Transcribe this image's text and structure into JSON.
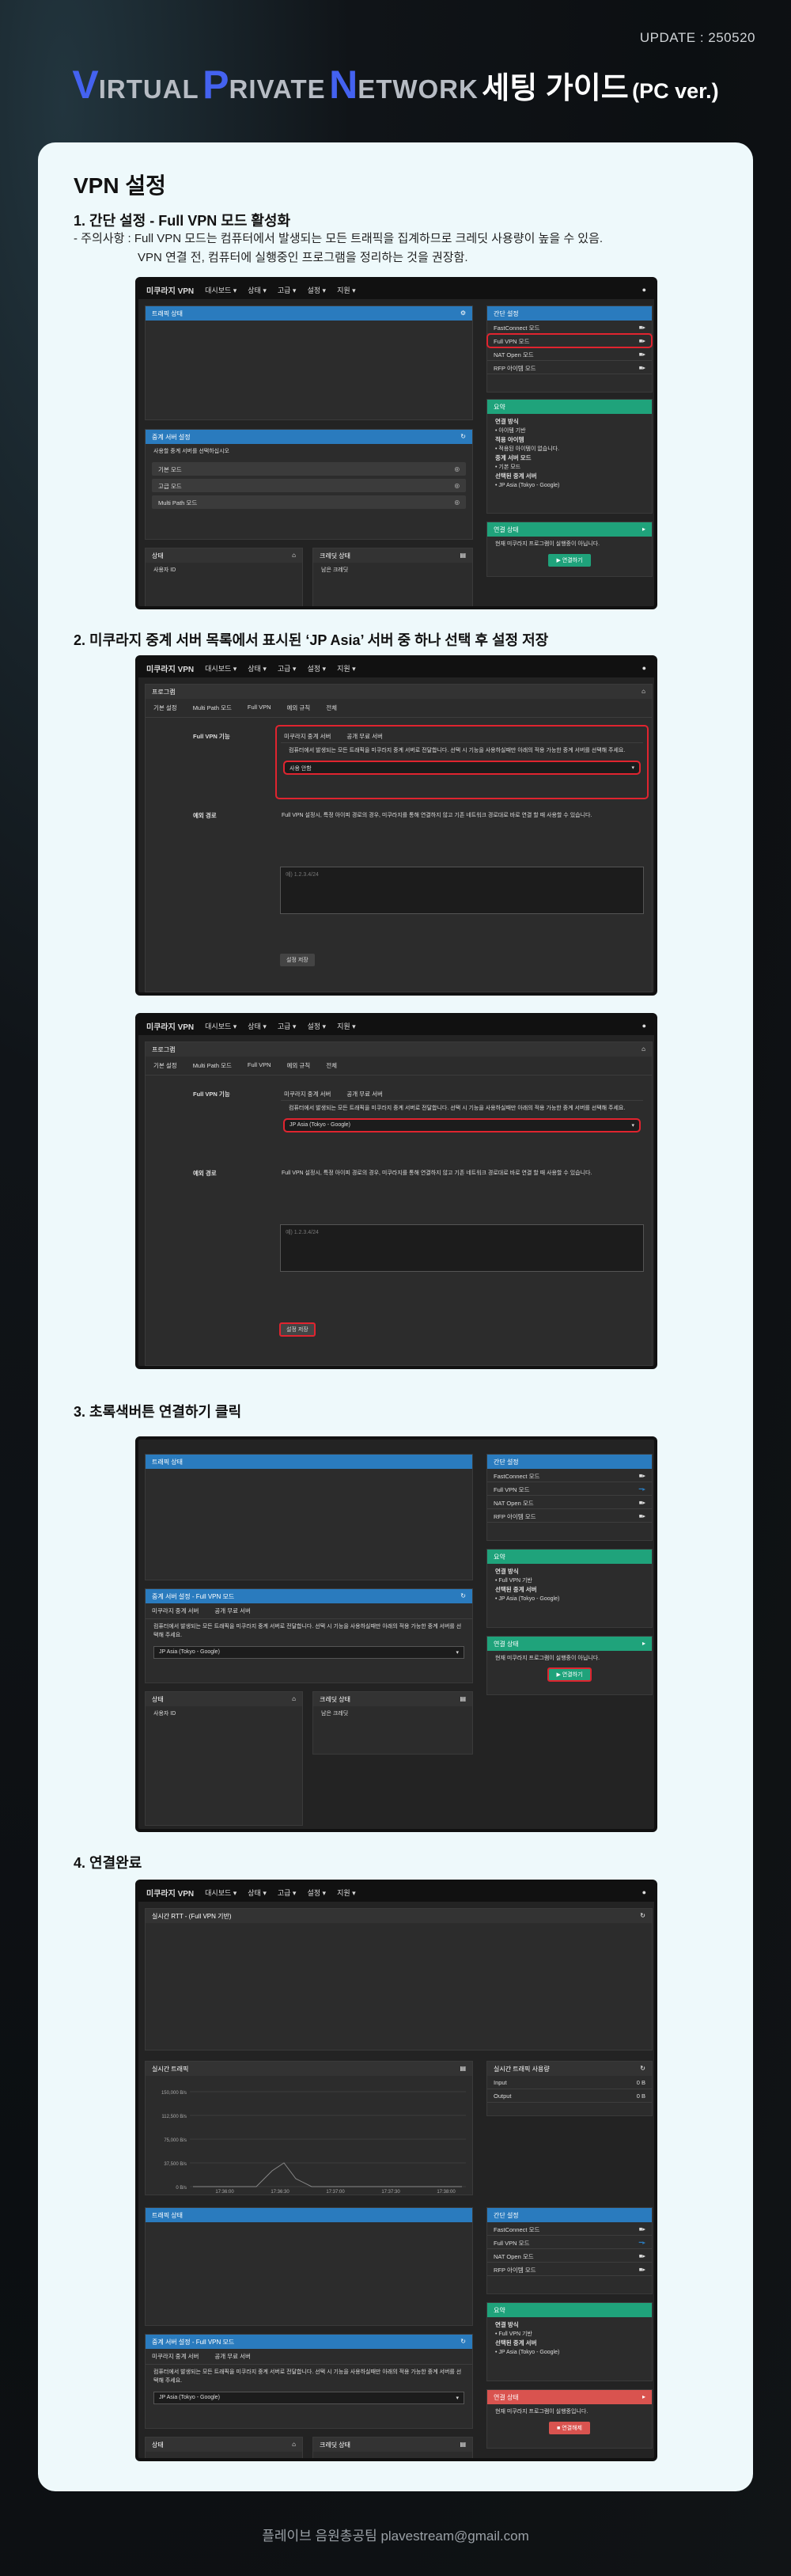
{
  "update": "UPDATE : 250520",
  "hero": {
    "w1_cap": "V",
    "w1": "IRTUAL",
    "w2_cap": "P",
    "w2": "RIVATE",
    "w3_cap": "N",
    "w3": "ETWORK",
    "ko": "세팅 가이드",
    "pc": "(PC ver.)"
  },
  "page_title": "VPN 설정",
  "step1": {
    "title": "1. 간단 설정 - Full VPN 모드 활성화",
    "note1": "-  주의사항 : Full VPN 모드는 컴퓨터에서 발생되는 모든 트래픽을 집계하므로 크레딧 사용량이 높을 수 있음.",
    "note2": "VPN 연결 전, 컴퓨터에 실행중인 프로그램을 정리하는 것을 권장함."
  },
  "step2": {
    "title": "2. 미쿠라지 중계 서버 목록에서 표시된 ‘JP Asia’ 서버 중 하나 선택 후 설정 저장"
  },
  "step3": {
    "title": "3. 초록색버튼 연결하기 클릭"
  },
  "step4": {
    "title": "4. 연결완료"
  },
  "app": {
    "brand": "미쿠라지 VPN",
    "nav": [
      "대시보드 ▾",
      "상태 ▾",
      "고급 ▾",
      "설정 ▾",
      "지원 ▾"
    ],
    "traffic_title": "트래픽 상태",
    "relay_title": "중계 서버 설정",
    "relay_title_full": "중계 서버 설정 - Full VPN 모드",
    "relay_hint": "사용할 중계 서버를 선택하십시오",
    "relay_opts": [
      "기본 모드",
      "고급 모드",
      "Multi Path 모드"
    ],
    "simple_title": "간단 설정",
    "modes": [
      "FastConnect 모드",
      "Full VPN 모드",
      "NAT Open 모드",
      "RFP 아이템 모드"
    ],
    "summary_title": "요약",
    "summary_lines": [
      "연결 방식",
      "• 아이템 기반",
      "적용 아이템",
      "• 적용된 아이템이 없습니다.",
      "중계 서버 모드",
      "• 기본 모드",
      "선택된 중계 서버",
      "• JP Asia (Tokyo - Google)"
    ],
    "summary3": [
      "연결 방식",
      "• Full VPN 기반",
      "선택된 중계 서버",
      "• JP Asia (Tokyo - Google)"
    ],
    "conn_title": "연결 상태",
    "conn_msg": "현재 미쿠라지 프로그램이 실행중이 아닙니다.",
    "conn_btn": "▶ 연결하기",
    "conn_msg4": "현재 미쿠라지 프로그램이 실행중입니다.",
    "disc_btn": "■ 연결해제",
    "status_title": "상태",
    "user_id": "사용자 ID",
    "credit_title": "크레딧 상태",
    "credit_value": "남은 크레딧",
    "program_title": "프로그램",
    "tabs": [
      "기본 설정",
      "Multi Path 모드",
      "Full VPN",
      "예외 규칙",
      "전체"
    ],
    "fullvpn_label": "Full VPN 기능",
    "relay_tab1": "미쿠라지 중계 서버",
    "relay_tab2": "공개 무료 서버",
    "relay_desc": "컴퓨터에서 발생되는 모든 트래픽을 미쿠라지 중계 서버로 전달합니다. 선택 시 기능을 사용하실때만 아래의 적용 가능한 중계 서버를 선택해 주세요.",
    "sel_default": "사용 안함",
    "sel_jp": "JP Asia (Tokyo - Google)",
    "exception_label": "예외 경로",
    "exception_desc": "Full VPN 설정시, 특정 아이피 경로의 경우, 미쿠라지를 통해 연결하지 않고 기존 네트워크 경로대로 바로 연결 할 때 사용할 수 있습니다.",
    "exception_placeholder": "예) 1.2.3.4/24",
    "save_btn": "설정 저장",
    "ping_title": "실시간 RTT - (Full VPN 기반)",
    "traffic_chart_title": "실시간 트래픽",
    "usage_title": "실시간 트래픽 사용량",
    "input_label": "Input",
    "output_label": "Output",
    "zero": "0 B",
    "chart_ticks": [
      "150,000 B/s",
      "112,500 B/s",
      "75,000 B/s",
      "37,500 B/s",
      "0 B/s"
    ],
    "chart_times": [
      "17:36:00",
      "17:36:30",
      "17:37:00",
      "17:37:30",
      "17:38:00"
    ]
  },
  "footer": "플레이브 음원총공팀 plavestream@gmail.com"
}
